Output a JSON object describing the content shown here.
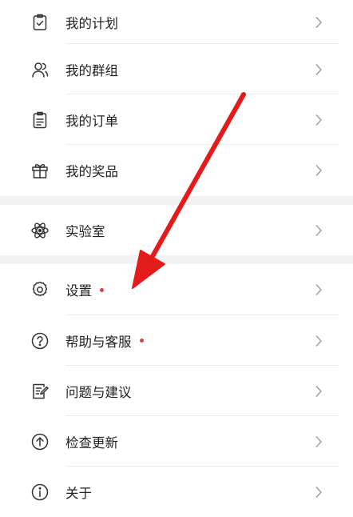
{
  "groups": [
    {
      "items": [
        {
          "label": "我的计划",
          "icon": "plan-icon",
          "dot": false
        },
        {
          "label": "我的群组",
          "icon": "group-icon",
          "dot": false
        },
        {
          "label": "我的订单",
          "icon": "order-icon",
          "dot": false
        },
        {
          "label": "我的奖品",
          "icon": "gift-icon",
          "dot": false
        }
      ]
    },
    {
      "items": [
        {
          "label": "实验室",
          "icon": "lab-atom-icon",
          "dot": false
        }
      ]
    },
    {
      "items": [
        {
          "label": "设置",
          "icon": "settings-gear-icon",
          "dot": true
        },
        {
          "label": "帮助与客服",
          "icon": "help-icon",
          "dot": true
        },
        {
          "label": "问题与建议",
          "icon": "feedback-icon",
          "dot": false
        },
        {
          "label": "检查更新",
          "icon": "update-icon",
          "dot": false
        },
        {
          "label": "关于",
          "icon": "about-info-icon",
          "dot": false
        }
      ]
    }
  ],
  "colors": {
    "notification_dot": "#e33e3e",
    "annotation_arrow": "#e31b1b",
    "icon_stroke": "#333333",
    "chevron": "#9a9a9a",
    "section_gap": "#f2f2f2"
  }
}
